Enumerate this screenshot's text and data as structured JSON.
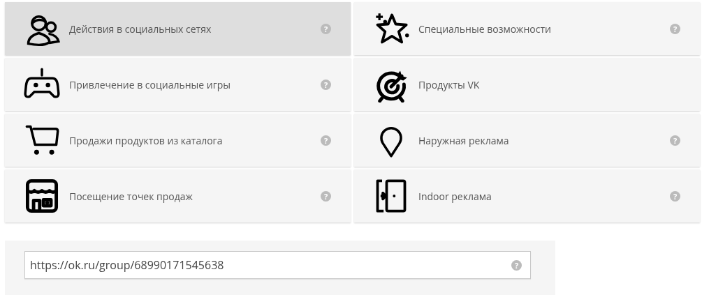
{
  "options": [
    {
      "label": "Действия в социальных сетях",
      "selected": true,
      "help": "?"
    },
    {
      "label": "Специальные возможности",
      "selected": false,
      "help": "?"
    },
    {
      "label": "Привлечение в социальные игры",
      "selected": false,
      "help": "?"
    },
    {
      "label": "Продукты VK",
      "selected": false
    },
    {
      "label": "Продажи продуктов из каталога",
      "selected": false,
      "help": "?"
    },
    {
      "label": "Наружная реклама",
      "selected": false,
      "help": "?"
    },
    {
      "label": "Посещение точек продаж",
      "selected": false,
      "help": "?"
    },
    {
      "label": "Indoor реклама",
      "selected": false,
      "help": "?"
    }
  ],
  "link_field": {
    "value": "https://ok.ru/group/68990171545638",
    "help": "?"
  }
}
